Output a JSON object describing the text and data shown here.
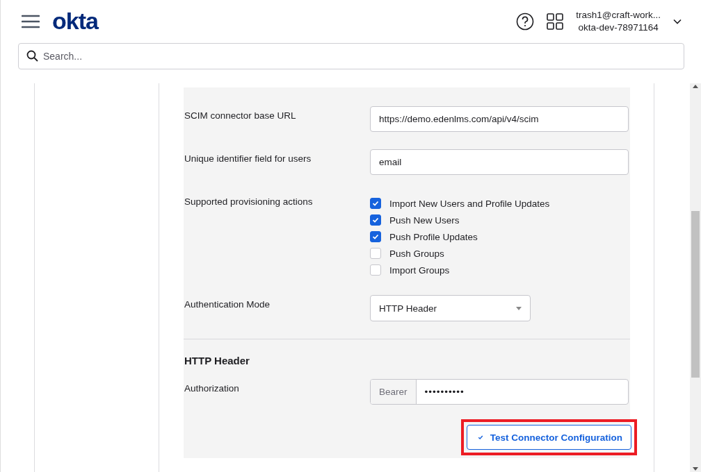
{
  "header": {
    "logo": "okta",
    "account": {
      "email": "trash1@craft-work...",
      "org": "okta-dev-78971164"
    }
  },
  "search": {
    "placeholder": "Search..."
  },
  "form": {
    "fields": [
      {
        "kind": "text",
        "label": "SCIM connector base URL",
        "value": "https://demo.edenlms.com/api/v4/scim"
      },
      {
        "kind": "text",
        "label": "Unique identifier field for users",
        "value": "email"
      },
      {
        "kind": "checkboxes",
        "label": "Supported provisioning actions",
        "options": [
          {
            "label": "Import New Users and Profile Updates",
            "checked": true
          },
          {
            "label": "Push New Users",
            "checked": true
          },
          {
            "label": "Push Profile Updates",
            "checked": true
          },
          {
            "label": "Push Groups",
            "checked": false
          },
          {
            "label": "Import Groups",
            "checked": false
          }
        ]
      },
      {
        "kind": "select",
        "label": "Authentication Mode",
        "value": "HTTP Header"
      }
    ],
    "section": {
      "title": "HTTP Header",
      "label": "Authorization",
      "prefix": "Bearer",
      "value": "••••••••••"
    },
    "button": {
      "label": "Test Connector Configuration",
      "highlighted": true
    }
  }
}
